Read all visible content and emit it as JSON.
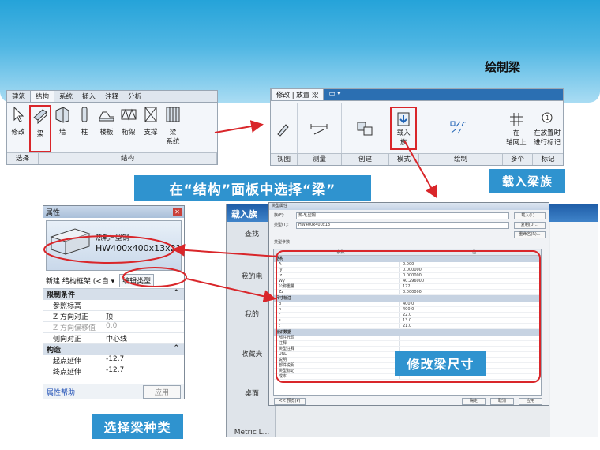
{
  "title": "绘制梁",
  "ribbon_structure": {
    "tabs": [
      "建筑",
      "结构",
      "系统",
      "插入",
      "注释",
      "分析"
    ],
    "active_tab": "结构",
    "tools": [
      {
        "label": "修改",
        "icon": "cursor-arrow-icon"
      },
      {
        "label": "梁",
        "icon": "beam-icon"
      },
      {
        "label": "墙",
        "icon": "wall-icon"
      },
      {
        "label": "柱",
        "icon": "column-icon"
      },
      {
        "label": "楼板",
        "icon": "floor-icon"
      },
      {
        "label": "桁架",
        "icon": "truss-icon"
      },
      {
        "label": "支撑",
        "icon": "brace-icon"
      },
      {
        "label": "梁",
        "label2": "系统",
        "icon": "beam-system-icon"
      }
    ],
    "groups": [
      "选择",
      "结构"
    ]
  },
  "ribbon_place_beam": {
    "tabs": [
      "修改 | 放置 梁",
      "▭ ▾"
    ],
    "load_family": {
      "line1": "载入",
      "line2": "族"
    },
    "on_axis": {
      "line1": "在",
      "line2": "轴网上"
    },
    "tag": {
      "line1": "在放置时",
      "line2": "进行标记"
    },
    "groups": [
      "视图",
      "测量",
      "创建",
      "模式",
      "绘制",
      "多个",
      "标记"
    ]
  },
  "callouts": {
    "select_beam": "在“结构”面板中选择“梁”",
    "load_beam_family": "载入梁族",
    "modify_size": "修改梁尺寸",
    "select_type": "选择梁种类"
  },
  "properties": {
    "title": "属性",
    "type_family": "热轧H型钢",
    "type_name": "HW400x400x13x21",
    "instance_selector": "新建 结构框架 (<自 ▾",
    "edit_type": "编辑类型",
    "section_constraints": "限制条件",
    "rows": [
      {
        "k": "参照标高",
        "v": ""
      },
      {
        "k": "Z 方向对正",
        "v": "顶"
      },
      {
        "k": "Z 方向偏移值",
        "v": "0.0"
      },
      {
        "k": "侧向对正",
        "v": "中心线"
      }
    ],
    "section_geometry": "构造",
    "rows2": [
      {
        "k": "起点延伸",
        "v": "-12.7"
      },
      {
        "k": "终点延伸",
        "v": "-12.7"
      }
    ],
    "help_link": "属性帮助",
    "apply": "应用"
  },
  "load_window": {
    "title": "载入族",
    "side_items": [
      "查找",
      "我的电",
      "我的",
      "收藏夹",
      "桌面",
      "Metric L..."
    ]
  },
  "type_dialog": {
    "title": "类型属性",
    "family_label": "族(F):",
    "family_value": "热-轧型钢",
    "type_label": "类型(T):",
    "type_value": "HW400x400x13",
    "btn_load": "载入(L)...",
    "btn_dup": "复制(D)...",
    "btn_rename": "重命名(R)...",
    "param_label": "类型参数",
    "col_param": "参数",
    "col_value": "值",
    "sections": [
      {
        "name": "结构",
        "rows": [
          [
            "A",
            "0.000"
          ],
          [
            "Iy",
            "0.000000"
          ],
          [
            "Iz",
            "0.000000"
          ],
          [
            "Wy",
            "40.296000"
          ],
          [
            "公称重量",
            "172"
          ],
          [
            "Zz",
            "0.000000"
          ]
        ]
      },
      {
        "name": "尺寸标注",
        "rows": [
          [
            "b",
            "400.0"
          ],
          [
            "h",
            "400.0"
          ],
          [
            "r",
            "22.0"
          ],
          [
            "s",
            "13.0"
          ],
          [
            "t",
            "21.0"
          ]
        ]
      },
      {
        "name": "标识数据",
        "rows": [
          [
            "部件代码",
            ""
          ],
          [
            "注释",
            ""
          ],
          [
            "类型注释",
            ""
          ],
          [
            "URL",
            ""
          ],
          [
            "说明",
            ""
          ],
          [
            "部件说明",
            ""
          ],
          [
            "类型标记",
            ""
          ],
          [
            "成本",
            ""
          ]
        ]
      }
    ],
    "ok": "确定",
    "cancel": "取消",
    "apply": "应用",
    "preview": "<< 预览(P)"
  }
}
